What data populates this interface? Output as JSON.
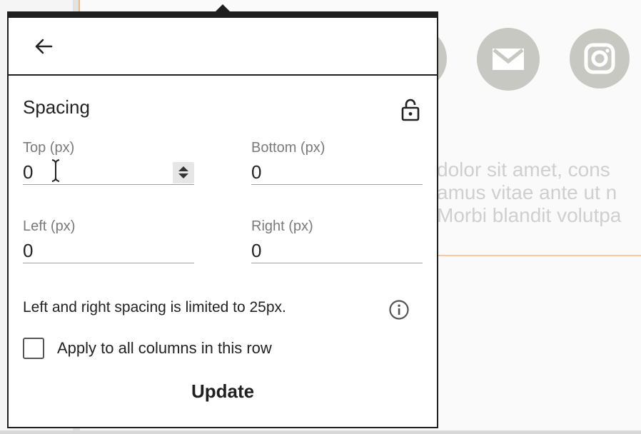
{
  "background": {
    "body_text_lines": [
      "dolor sit amet, cons",
      "amus vitae ante ut n",
      "Morbi blandit volutpa"
    ],
    "social_icons": [
      "circle-icon",
      "mail-icon",
      "instagram-icon"
    ],
    "colors": {
      "social_bg": "#c8c8c2",
      "accent_line": "#f0b489"
    }
  },
  "popover": {
    "back_icon": "arrow-left-icon",
    "section_title": "Spacing",
    "lock_icon": "lock-open-icon",
    "fields": {
      "top": {
        "label": "Top (px)",
        "value": "0"
      },
      "bottom": {
        "label": "Bottom (px)",
        "value": "0"
      },
      "left": {
        "label": "Left (px)",
        "value": "0"
      },
      "right": {
        "label": "Right (px)",
        "value": "0"
      }
    },
    "info_text": "Left and right spacing is limited to 25px.",
    "info_icon": "info-icon",
    "apply_all": {
      "label": "Apply to all columns in this row",
      "checked": false
    },
    "update_label": "Update"
  }
}
